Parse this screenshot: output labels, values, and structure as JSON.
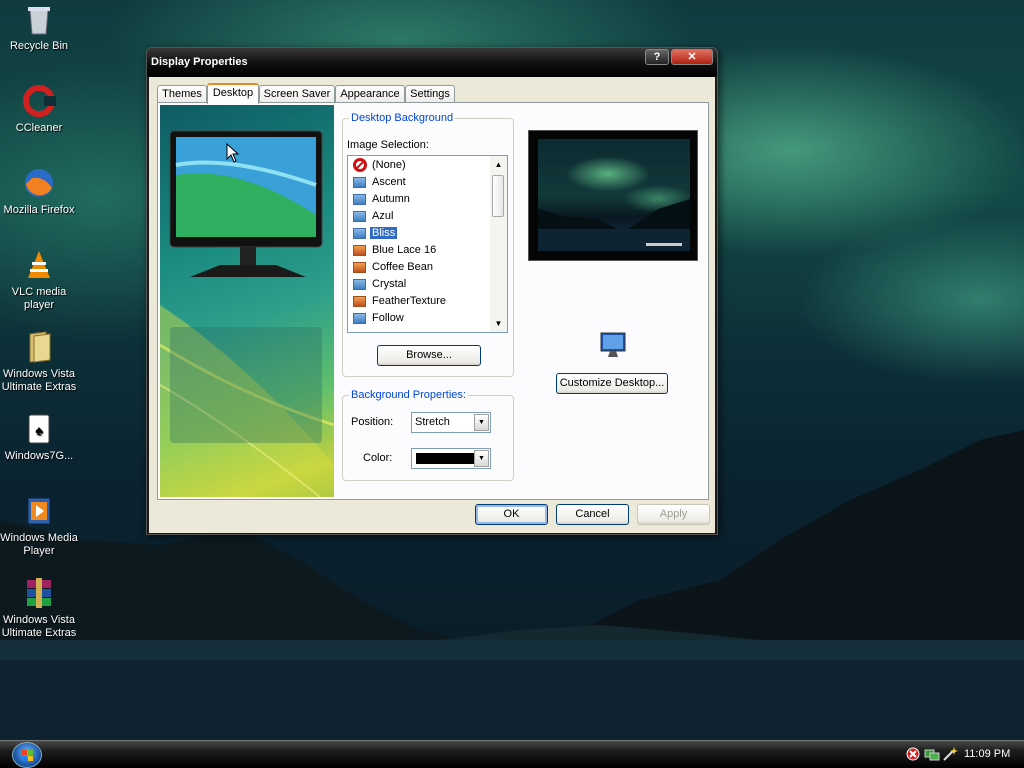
{
  "desktop": {
    "icons": [
      {
        "label": "Recycle Bin"
      },
      {
        "label": "CCleaner"
      },
      {
        "label": "Mozilla Firefox"
      },
      {
        "label": "VLC media player"
      },
      {
        "label": "Windows Vista Ultimate Extras"
      },
      {
        "label": "Windows7G..."
      },
      {
        "label": "Windows Media Player"
      },
      {
        "label": "Windows Vista Ultimate Extras"
      }
    ]
  },
  "window": {
    "title": "Display Properties",
    "help_label": "?",
    "close_label": "✕",
    "tabs": [
      {
        "label": "Themes"
      },
      {
        "label": "Desktop"
      },
      {
        "label": "Screen Saver"
      },
      {
        "label": "Appearance"
      },
      {
        "label": "Settings"
      }
    ],
    "desktop_background": {
      "title": "Desktop Background",
      "image_selection_label": "Image Selection:",
      "items": [
        {
          "label": "(None)"
        },
        {
          "label": "Ascent"
        },
        {
          "label": "Autumn"
        },
        {
          "label": "Azul"
        },
        {
          "label": "Bliss"
        },
        {
          "label": "Blue Lace 16"
        },
        {
          "label": "Coffee Bean"
        },
        {
          "label": "Crystal"
        },
        {
          "label": "FeatherTexture"
        },
        {
          "label": "Follow"
        }
      ],
      "selected": "Bliss",
      "browse_label": "Browse..."
    },
    "background_properties": {
      "title": "Background Properties:",
      "position_label": "Position:",
      "position_value": "Stretch",
      "color_label": "Color:",
      "color_value": "#000000"
    },
    "customize_label": "Customize Desktop...",
    "ok_label": "OK",
    "cancel_label": "Cancel",
    "apply_label": "Apply"
  },
  "taskbar": {
    "clock": "11:09 PM"
  },
  "colors": {
    "selection": "#316ac5",
    "group_title": "#0046d5",
    "dialog_bg": "#ece9d8"
  }
}
